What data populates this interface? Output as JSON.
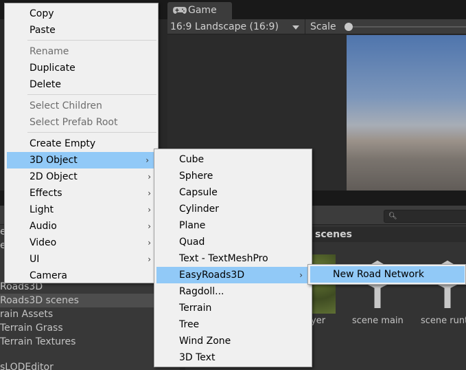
{
  "game_panel": {
    "tab_label": "Game",
    "aspect_dropdown": "16:9 Landscape (16:9)",
    "scale_label": "Scale"
  },
  "project_panel": {
    "tree_items": [
      {
        "label": "es"
      },
      {
        "label": "e"
      },
      {
        "label": "Roads3D"
      },
      {
        "label": "Roads3D scenes",
        "selected": true
      },
      {
        "label": "rain Assets"
      },
      {
        "label": "Terrain Grass"
      },
      {
        "label": "Terrain Textures"
      },
      {
        "label": "sLODEditor"
      }
    ],
    "folder_title": "scenes",
    "assets": [
      {
        "label": "yer",
        "icon": "grass-texture-thumbnail"
      },
      {
        "label": "scene main",
        "icon": "unity-scene-icon"
      },
      {
        "label": "scene runt",
        "icon": "unity-scene-icon"
      }
    ]
  },
  "context_menu": {
    "items": [
      {
        "label": "Copy"
      },
      {
        "label": "Paste"
      },
      {
        "label": "Rename",
        "disabled": true
      },
      {
        "label": "Duplicate"
      },
      {
        "label": "Delete"
      },
      {
        "label": "Select Children",
        "disabled": true
      },
      {
        "label": "Select Prefab Root",
        "disabled": true
      },
      {
        "label": "Create Empty"
      },
      {
        "label": "3D Object",
        "submenu": true,
        "highlighted": true
      },
      {
        "label": "2D Object",
        "submenu": true
      },
      {
        "label": "Effects",
        "submenu": true
      },
      {
        "label": "Light",
        "submenu": true
      },
      {
        "label": "Audio",
        "submenu": true
      },
      {
        "label": "Video",
        "submenu": true
      },
      {
        "label": "UI",
        "submenu": true
      },
      {
        "label": "Camera"
      }
    ]
  },
  "submenu_3d_object": {
    "items": [
      {
        "label": "Cube"
      },
      {
        "label": "Sphere"
      },
      {
        "label": "Capsule"
      },
      {
        "label": "Cylinder"
      },
      {
        "label": "Plane"
      },
      {
        "label": "Quad"
      },
      {
        "label": "Text - TextMeshPro"
      },
      {
        "label": "EasyRoads3D",
        "submenu": true,
        "highlighted": true
      },
      {
        "label": "Ragdoll..."
      },
      {
        "label": "Terrain"
      },
      {
        "label": "Tree"
      },
      {
        "label": "Wind Zone"
      },
      {
        "label": "3D Text"
      }
    ]
  },
  "submenu_easyroads3d": {
    "items": [
      {
        "label": "New Road Network",
        "highlighted": true
      }
    ]
  },
  "colors": {
    "menu_bg": "#f0f0f0",
    "menu_highlight": "#91c9f7",
    "menu_disabled_text": "#6d6d6d",
    "editor_bg": "#282828"
  }
}
